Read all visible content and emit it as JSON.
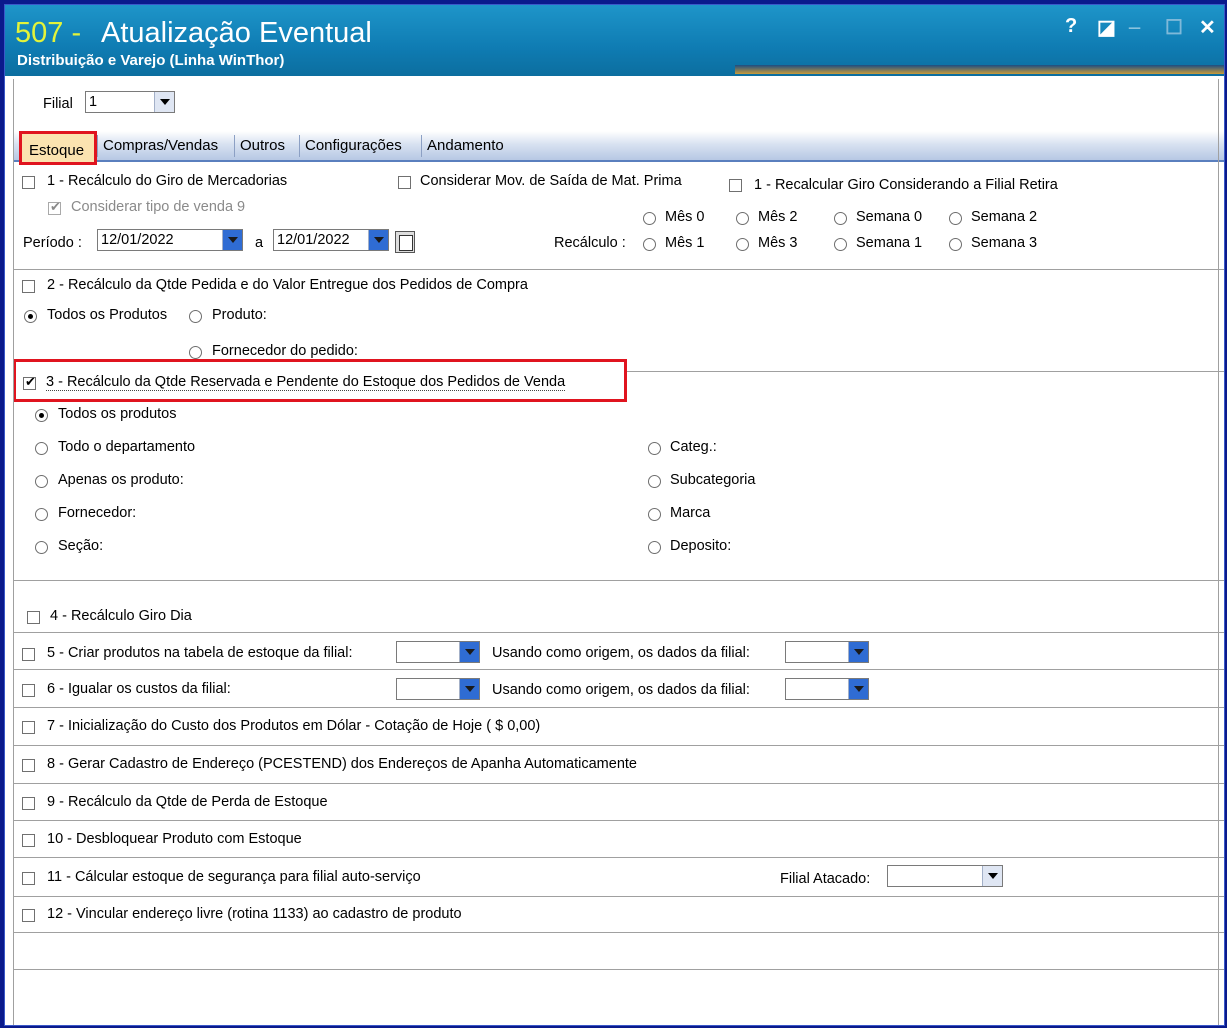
{
  "window": {
    "number": "507 -",
    "title": "Atualização Eventual",
    "subtitle": "Distribuição e Varejo (Linha WinThor)",
    "buttons": {
      "help": "?",
      "restore": "◪",
      "minimize": "_",
      "maximize": "☐",
      "close": "✕"
    }
  },
  "filial": {
    "label": "Filial",
    "value": "1"
  },
  "tabs": [
    "Estoque",
    "Compras/Vendas",
    "Outros",
    "Configurações",
    "Andamento"
  ],
  "section1": {
    "title": "1 - Recálculo do Giro de Mercadorias",
    "considerar_mov": "Considerar Mov. de Saída de Mat. Prima",
    "recalcular_giro": "1 - Recalcular Giro Considerando a Filial Retira",
    "considerar_tipo": "Considerar tipo de venda 9",
    "periodo_label": "Período :",
    "periodo_de": "12/01/2022",
    "periodo_sep": "a",
    "periodo_ate": "12/01/2022",
    "recalculo_label": "Recálculo :",
    "options_row1": [
      "Mês 0",
      "Mês 2",
      "Semana 0",
      "Semana 2"
    ],
    "options_row2": [
      "Mês 1",
      "Mês 3",
      "Semana 1",
      "Semana 3"
    ]
  },
  "section2": {
    "title": "2 - Recálculo da Qtde Pedida e do Valor Entregue dos Pedidos de Compra",
    "todos": "Todos os Produtos",
    "produto": "Produto:",
    "fornecedor": "Fornecedor do pedido:"
  },
  "section3": {
    "title": "3 - Recálculo da Qtde Reservada e Pendente do Estoque dos Pedidos de Venda",
    "left_options": [
      "Todos os produtos",
      "Todo o departamento",
      "Apenas os produto:",
      "Fornecedor:",
      "Seção:"
    ],
    "right_options": [
      "Categ.:",
      "Subcategoria",
      "Marca",
      "Deposito:"
    ]
  },
  "section4": {
    "title": "4 - Recálculo Giro Dia"
  },
  "section5": {
    "title": "5 - Criar produtos na tabela de estoque da filial:",
    "origem": "Usando como origem, os dados da filial:"
  },
  "section6": {
    "title": "6 - Igualar os custos da filial:",
    "origem": "Usando como origem, os dados da filial:"
  },
  "section7": {
    "title": "7 - Inicialização do Custo dos Produtos em Dólar - Cotação de Hoje ( $ 0,00)"
  },
  "section8": {
    "title": "8 - Gerar Cadastro de Endereço (PCESTEND) dos Endereços de Apanha Automaticamente"
  },
  "section9": {
    "title": "9 - Recálculo da Qtde de Perda de Estoque"
  },
  "section10": {
    "title": "10 - Desbloquear Produto com Estoque"
  },
  "section11": {
    "title": "11 - Cálcular estoque de segurança para filial auto-serviço",
    "filial_atacado": "Filial Atacado:"
  },
  "section12": {
    "title": "12 - Vincular endereço livre (rotina 1133) ao cadastro de produto"
  },
  "colors": {
    "titlebar": "#1582bd",
    "highlight": "#e0141f",
    "tab_active": "#fbe3b0",
    "number": "#e3f33a"
  }
}
